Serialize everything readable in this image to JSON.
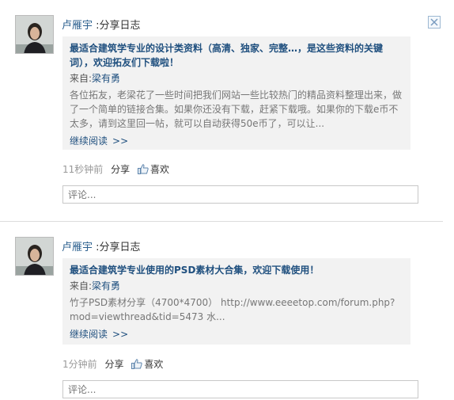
{
  "posts": [
    {
      "user": "卢雁宇",
      "action": ":分享日志",
      "title": "最适合建筑学专业的设计类资料（高清、独家、完整…，是这些资料的关键词），欢迎拓友们下载啦！",
      "source_prefix": "来自:",
      "source_user": "梁有勇",
      "body": "各位拓友，老梁花了一些时间把我们网站一些比较热门的精品资料整理出来，做了一个简单的链接合集。如果你还没有下载，赶紧下载哦。如果你的下载e币不太多，请到这里回一帖，就可以自动获得50e币了，可以让...",
      "more_label": "继续阅读",
      "more_arrows": ">>",
      "time": "11秒钟前",
      "share_label": "分享",
      "like_label": "喜欢",
      "comment_placeholder": "评论..."
    },
    {
      "user": "卢雁宇",
      "action": ":分享日志",
      "title": "最适合建筑学专业使用的PSD素材大合集，欢迎下载使用！",
      "source_prefix": "来自:",
      "source_user": "梁有勇",
      "body": "竹子PSD素材分享（4700*4700） http://www.eeeetop.com/forum.php?mod=viewthread&tid=5473 水...",
      "more_label": "继续阅读",
      "more_arrows": ">>",
      "time": "1分钟前",
      "share_label": "分享",
      "like_label": "喜欢",
      "comment_placeholder": "评论..."
    }
  ],
  "icons": {
    "close": "close-x-icon",
    "like": "thumbs-up-icon"
  }
}
